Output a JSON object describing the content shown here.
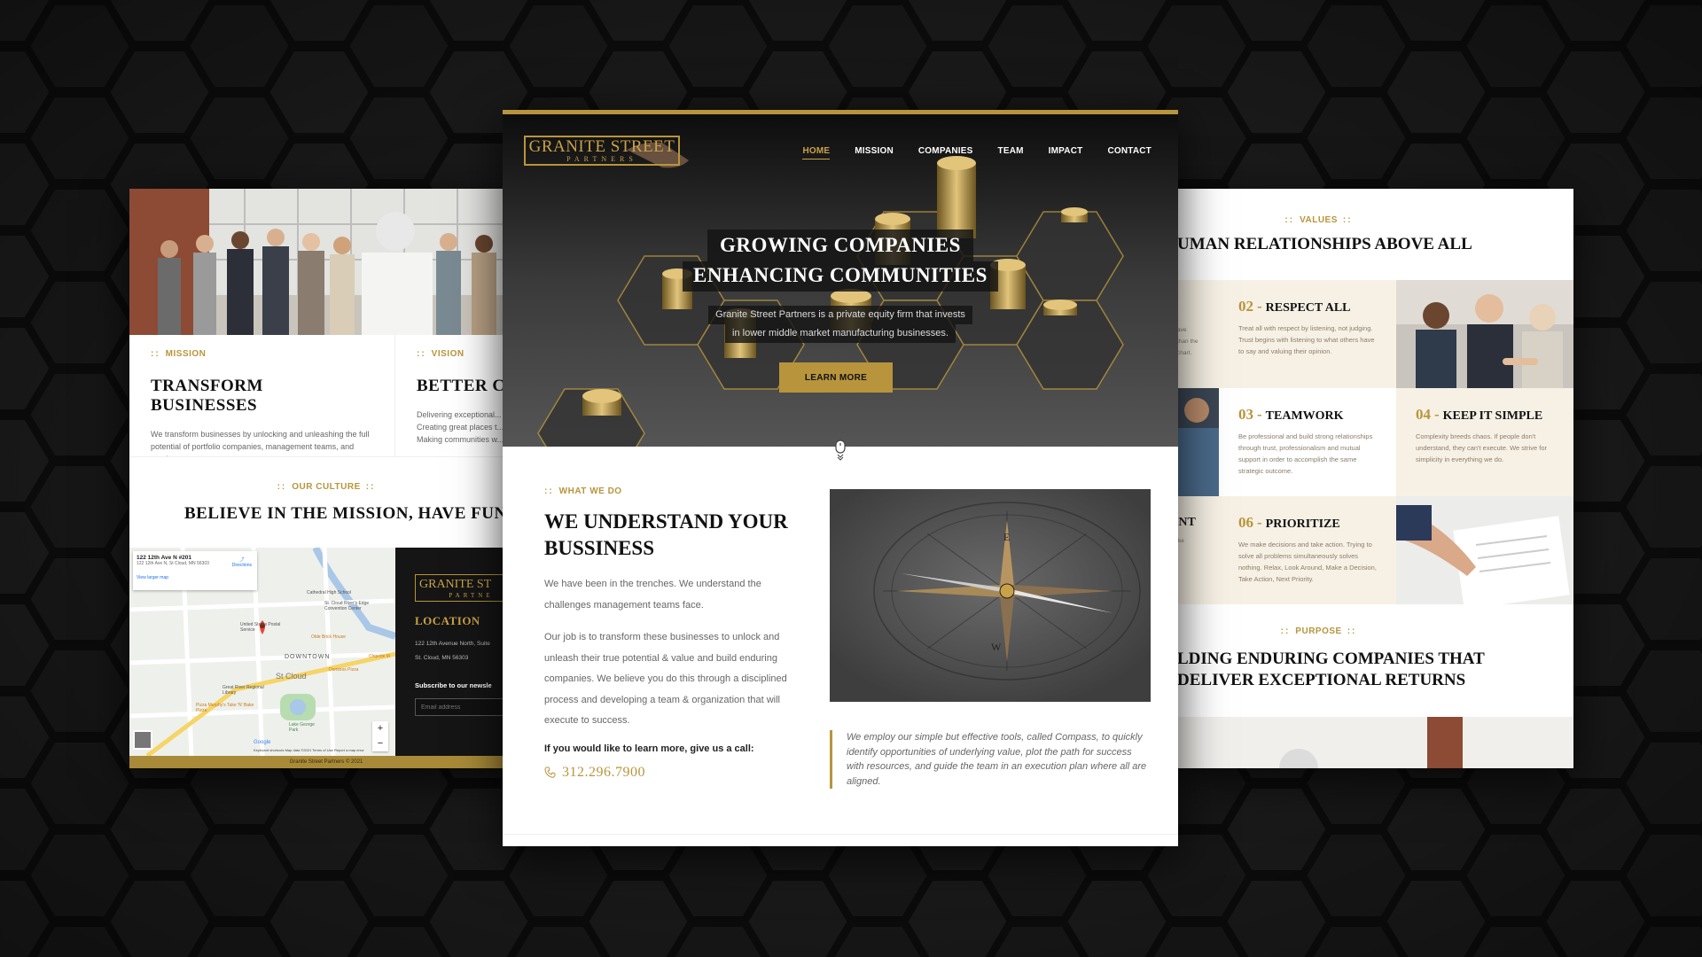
{
  "center": {
    "logo": {
      "line1": "GRANITE STREET",
      "line2": "PARTNERS"
    },
    "nav": [
      {
        "label": "HOME",
        "active": true
      },
      {
        "label": "MISSION"
      },
      {
        "label": "COMPANIES"
      },
      {
        "label": "TEAM"
      },
      {
        "label": "IMPACT"
      },
      {
        "label": "CONTACT"
      }
    ],
    "hero": {
      "title_line1": "GROWING COMPANIES",
      "title_line2": "ENHANCING COMMUNITIES",
      "sub_line1": "Granite Street Partners is a private equity firm that invests",
      "sub_line2": "in lower middle market manufacturing businesses.",
      "cta": "LEARN MORE"
    },
    "what_we_do": {
      "eyebrow": "WHAT WE DO",
      "heading": "WE UNDERSTAND YOUR BUSSINESS",
      "p1": "We have been in the trenches. We understand the challenges management teams face.",
      "p2": "Our job is to transform these businesses to unlock and unleash their true potential & value and build enduring companies. We believe you do this through a disciplined process and developing a team & organization that will execute to success.",
      "cta": "If you would like to learn more, give us a call:",
      "phone": "312.296.7900"
    },
    "quote": "We employ our simple but effective tools, called Compass, to quickly identify opportunities of underlying value, plot the path for success with resources, and guide the team in an execution plan where all are aligned."
  },
  "left": {
    "mission": {
      "eyebrow": "MISSION",
      "title": "TRANSFORM BUSINESSES",
      "text": "We transform businesses by unlocking and unleashing the full potential of portfolio companies, management teams, and employees."
    },
    "vision": {
      "eyebrow": "VISION",
      "title": "BETTER CO",
      "text": "Delivering exceptional... Creating great places t... Making communities w..."
    },
    "culture": {
      "eyebrow": "OUR CULTURE",
      "title": "BELIEVE IN THE MISSION, HAVE FUN, G"
    },
    "map": {
      "address_title": "122 12th Ave N #201",
      "address_sub": "122 12th Ave N, St Cloud, MN 56303",
      "directions": "Directions",
      "larger": "View larger map",
      "labels": [
        "Cathedral High School",
        "St. Cloud River's Edge Convention Center",
        "United States Postal Service",
        "Olde Brick House",
        "Dominos Pizza",
        "Chipotle M",
        "DOWNTOWN",
        "St Cloud",
        "Great River Regional Library",
        "Pizza Murphy's Take 'N' Bake Pizza",
        "Lake George Park",
        "Google",
        "Keyboard shortcuts",
        "Map data ©2021",
        "Terms of Use",
        "Report a map error"
      ]
    },
    "location": {
      "logo_line1": "GRANITE ST",
      "logo_line2": "PARTNE",
      "title": "LOCATION",
      "address1": "122 12th Avenue North, Suite",
      "address2": "St. Cloud, MN 56303",
      "subscribe": "Subscribe to our newsle",
      "email_placeholder": "Email address"
    },
    "footer": "Granite Street Partners © 2021"
  },
  "right": {
    "values_eyebrow": "VALUES",
    "values_heading": "UMAN RELATIONSHIPS ABOVE ALL",
    "items": [
      {
        "num": "02",
        "title": "RESPECT ALL",
        "text": "Treat all with respect by listening, not judging. Trust begins with listening to what others have to say and valuing their opinion."
      },
      {
        "num": "03",
        "title": "TEAMWORK",
        "text": "Be professional and build strong relationships through trust, professionalism and mutual support in order to accomplish the same strategic outcome."
      },
      {
        "num": "04",
        "title": "KEEP IT SIMPLE",
        "text": "Complexity breeds chaos. If people don't understand, they can't execute. We strive for simplicity in everything we do."
      },
      {
        "num": "06",
        "title": "PRIORITIZE",
        "text": "We make decisions and take action. Trying to solve all problems simultaneously solves nothing. Relax, Look Around, Make a Decision, Take Action, Next Priority."
      }
    ],
    "fragments": {
      "a": "ave",
      "b": "than the",
      "c": "chart.",
      "d": "ENT",
      "e": "make",
      "f": "ard"
    },
    "purpose_eyebrow": "PURPOSE",
    "purpose_line1": "LDING ENDURING COMPANIES THAT",
    "purpose_line2": "DELIVER EXCEPTIONAL RETURNS"
  },
  "colors": {
    "gold": "#b8953c",
    "dark": "#141414",
    "cream": "#f7f1e5"
  }
}
